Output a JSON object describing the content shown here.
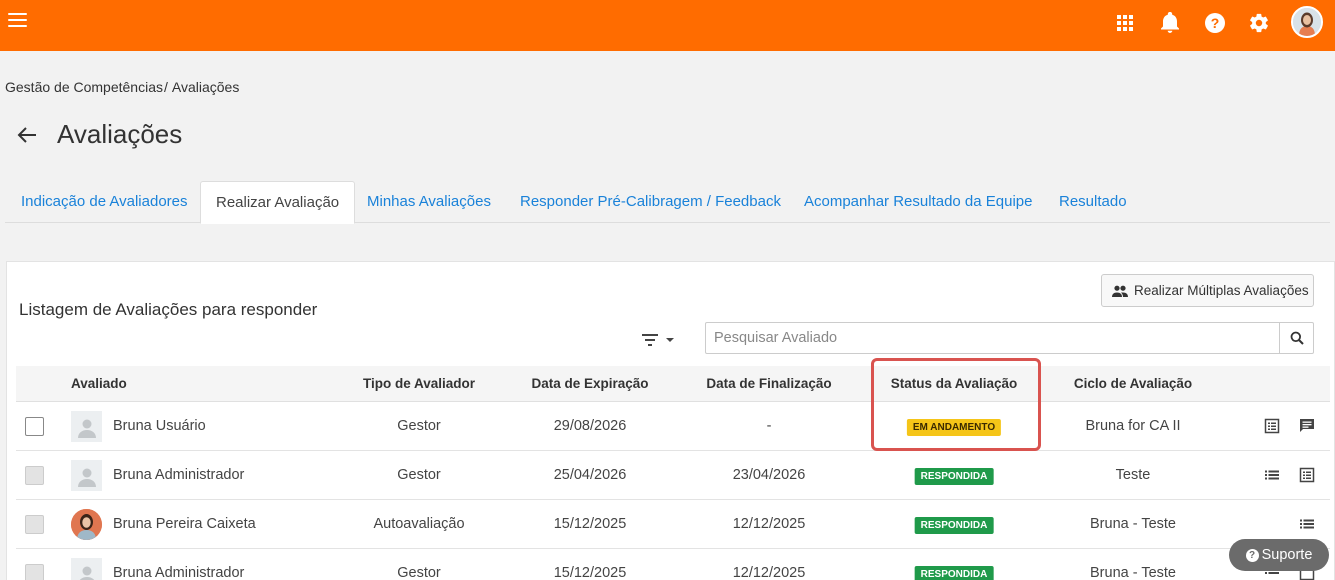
{
  "colors": {
    "topbar": "#ff6c00",
    "link": "#1a82d9",
    "badge_progress": "#f5c518",
    "badge_done": "#1f9a4a",
    "highlight": "#d9534f"
  },
  "topbar": {
    "icons": [
      "menu-icon",
      "apps-grid-icon",
      "bell-icon",
      "help-icon",
      "settings-icon",
      "user-avatar"
    ]
  },
  "breadcrumb": {
    "parent": "Gestão de Competências",
    "separator": "/",
    "current": "Avaliações"
  },
  "page": {
    "title": "Avaliações"
  },
  "tabs": [
    {
      "label": "Indicação de Avaliadores"
    },
    {
      "label": "Realizar Avaliação",
      "active": true
    },
    {
      "label": "Minhas Avaliações"
    },
    {
      "label": "Responder Pré-Calibragem / Feedback"
    },
    {
      "label": "Acompanhar Resultado da Equipe"
    },
    {
      "label": "Resultado"
    }
  ],
  "panel": {
    "multi_button": "Realizar Múltiplas Avaliações",
    "list_title": "Listagem de Avaliações para responder",
    "search_placeholder": "Pesquisar Avaliado"
  },
  "table": {
    "headers": {
      "avaliado": "Avaliado",
      "tipo": "Tipo de Avaliador",
      "expiracao": "Data de Expiração",
      "finalizacao": "Data de Finalização",
      "status": "Status da Avaliação",
      "ciclo": "Ciclo de Avaliação"
    },
    "rows": [
      {
        "name": "Bruna Usuário",
        "tipo": "Gestor",
        "expiracao": "29/08/2026",
        "finalizacao": "-",
        "status": "EM ANDAMENTO",
        "ciclo": "Bruna for CA II"
      },
      {
        "name": "Bruna Administrador",
        "tipo": "Gestor",
        "expiracao": "25/04/2026",
        "finalizacao": "23/04/2026",
        "status": "RESPONDIDA",
        "ciclo": "Teste"
      },
      {
        "name": "Bruna Pereira Caixeta",
        "tipo": "Autoavaliação",
        "expiracao": "15/12/2025",
        "finalizacao": "12/12/2025",
        "status": "RESPONDIDA",
        "ciclo": "Bruna - Teste"
      },
      {
        "name": "Bruna Administrador",
        "tipo": "Gestor",
        "expiracao": "15/12/2025",
        "finalizacao": "12/12/2025",
        "status": "RESPONDIDA",
        "ciclo": "Bruna - Teste"
      }
    ]
  },
  "support": {
    "label": "Suporte"
  }
}
